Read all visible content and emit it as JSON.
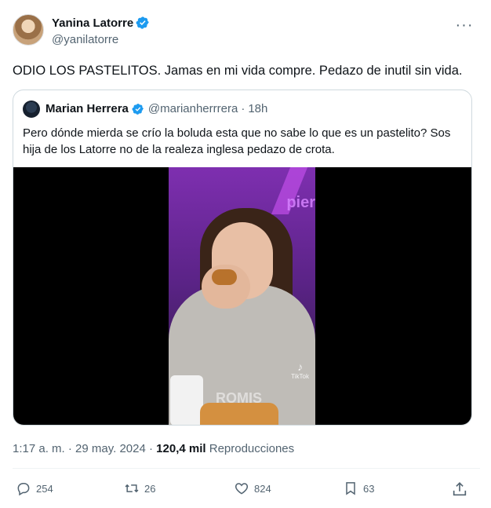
{
  "author": {
    "display_name": "Yanina Latorre",
    "handle": "@yanilatorre",
    "verified_color": "#1d9bf0"
  },
  "tweet": {
    "text": "ODIO LOS PASTELITOS. Jamas en mi vida compre. Pedazo de inutil sin vida."
  },
  "quoted": {
    "display_name": "Marian Herrera",
    "handle": "@marianherrrera",
    "separator": "·",
    "time": "18h",
    "text": "Pero dónde mierda se crío la boluda esta que no sabe lo que es un pastelito? Sos hija de los Latorre no de la realeza inglesa pedazo de crota.",
    "media": {
      "logo_text": "pier",
      "tiktok_label": "TikTok",
      "watermark": "ROMIS"
    }
  },
  "meta": {
    "time": "1:17 a. m.",
    "separator": "·",
    "date": "29 may. 2024",
    "views_count": "120,4 mil",
    "views_label": "Reproducciones"
  },
  "actions": {
    "replies": "254",
    "reposts": "26",
    "likes": "824",
    "bookmarks": "63"
  },
  "icons": {
    "more": "more-icon",
    "reply": "reply-icon",
    "repost": "repost-icon",
    "like": "like-icon",
    "bookmark": "bookmark-icon",
    "share": "share-icon"
  }
}
